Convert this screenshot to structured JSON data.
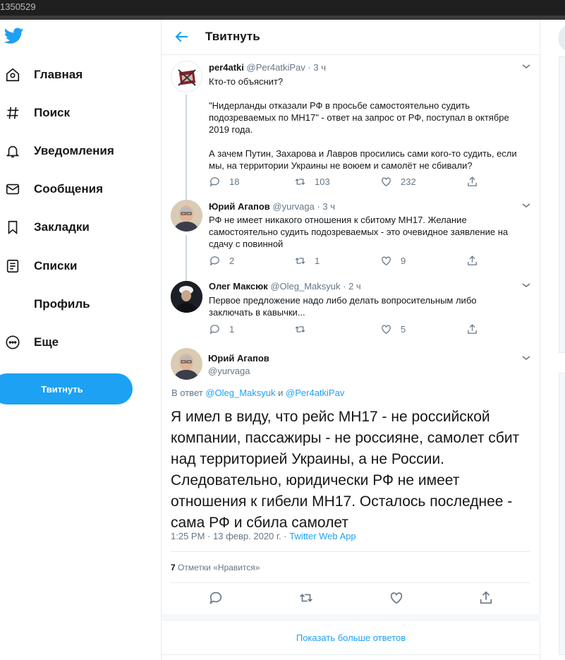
{
  "window": {
    "id_text": "1350529"
  },
  "sidebar": {
    "items": [
      {
        "label": "Главная",
        "icon": "home-icon"
      },
      {
        "label": "Поиск",
        "icon": "hash-icon"
      },
      {
        "label": "Уведомления",
        "icon": "bell-icon"
      },
      {
        "label": "Сообщения",
        "icon": "mail-icon"
      },
      {
        "label": "Закладки",
        "icon": "bookmark-icon"
      },
      {
        "label": "Списки",
        "icon": "list-icon"
      },
      {
        "label": "Профиль",
        "icon": ""
      },
      {
        "label": "Еще",
        "icon": "more-icon"
      }
    ],
    "tweet_button": "Твитнуть"
  },
  "header": {
    "title": "Твитнуть"
  },
  "thread": [
    {
      "name": "per4atki",
      "handle": "@Per4atkiPav",
      "time": "3 ч",
      "text_lines": [
        "Кто-то объяснит?",
        "",
        "\"Нидерланды отказали РФ в просьбе самостоятельно судить",
        "подозреваемых по МН17\" -  ответ на запрос от РФ, поступал в октябре",
        "2019 года.",
        "",
        "А зачем Путин, Захарова и Лавров просились сами кого-то судить, если",
        "мы, на территории Украины не воюем и самолёт не сбивали?"
      ],
      "replies": "18",
      "retweets": "103",
      "likes": "232"
    },
    {
      "name": "Юрий Агапов",
      "handle": "@yurvaga",
      "time": "3 ч",
      "text_lines": [
        "РФ не имеет никакого отношения к сбитому МН17. Желание",
        "самостоятельно судить подозреваемых - это очевидное заявление на",
        "сдачу с повинной"
      ],
      "replies": "2",
      "retweets": "1",
      "likes": "9"
    },
    {
      "name": "Олег Максюк",
      "handle": "@Oleg_Maksyuk",
      "time": "2 ч",
      "text_lines": [
        "Первое предложение надо либо делать вопросительным либо",
        "заключать в кавычки..."
      ],
      "replies": "1",
      "retweets": "",
      "likes": "5"
    }
  ],
  "main_tweet": {
    "name": "Юрий Агапов",
    "handle": "@yurvaga",
    "in_reply_prefix": "В ответ",
    "in_reply_user1": "@Oleg_Maksyuk",
    "in_reply_and": "и",
    "in_reply_user2": "@Per4atkiPav",
    "text": "Я имел в виду, что рейс МН17 - не российской компании, пассажиры - не россияне, самолет сбит над территорией Украины, а не России. Следовательно, юридически РФ не имеет отношения к гибели МН17. Осталось последнее - сама РФ и сбила самолет",
    "time": "1:25 PM",
    "date": "13 февр. 2020 г.",
    "source": "Twitter Web App",
    "like_count": "7",
    "like_label": "Отметки «Нравится»"
  },
  "show_more": "Показать больше ответов",
  "colors": {
    "accent": "#1da1f2",
    "text": "#14171a",
    "secondary": "#657786",
    "border": "#e6ecf0"
  }
}
